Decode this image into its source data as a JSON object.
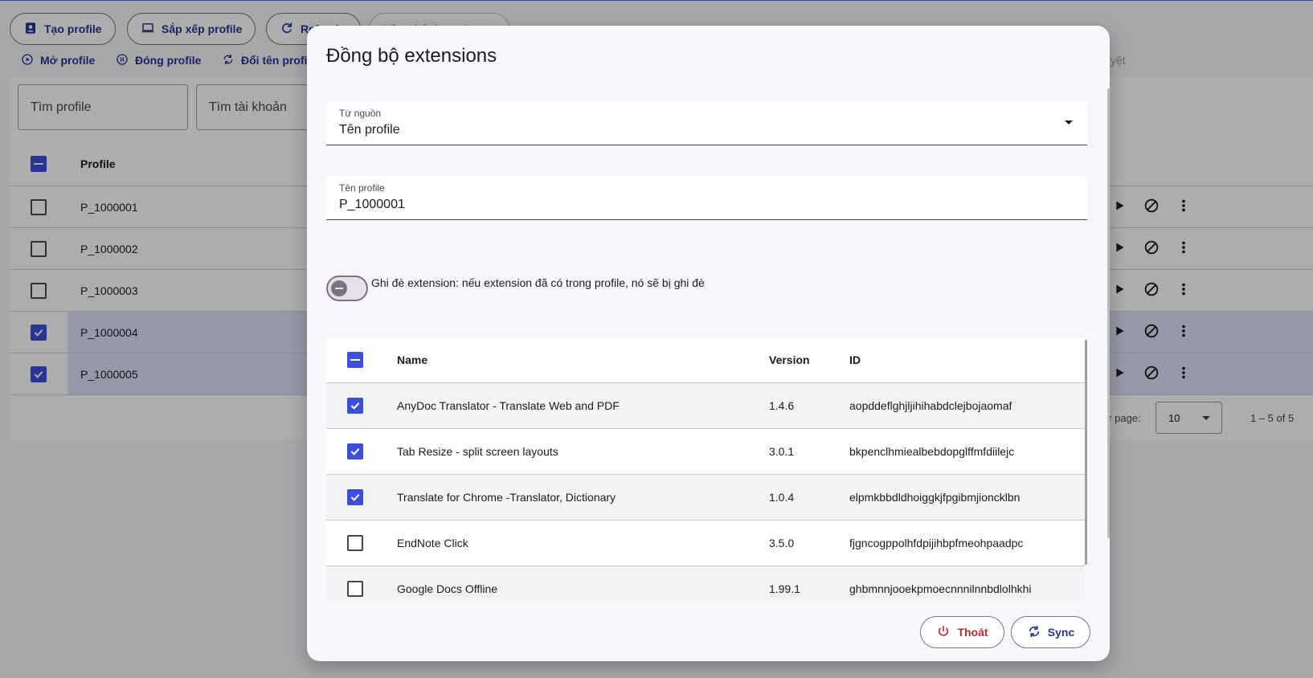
{
  "toolbar": {
    "create": "Tạo profile",
    "sort": "Sắp xếp profile",
    "refresh": "Refresh",
    "hidden_btn": "Đồng bộ thao tác",
    "open": "Mở profile",
    "close": "Đóng profile",
    "rename": "Đổi tên profil",
    "hidden_right": "yệt"
  },
  "search": {
    "profile_placeholder": "Tìm profile",
    "account_placeholder": "Tìm tài khoản"
  },
  "profile_table": {
    "header": "Profile",
    "rows": [
      {
        "name": "P_1000001",
        "checked": false
      },
      {
        "name": "P_1000002",
        "checked": false
      },
      {
        "name": "P_1000003",
        "checked": false
      },
      {
        "name": "P_1000004",
        "checked": true
      },
      {
        "name": "P_1000005",
        "checked": true
      }
    ]
  },
  "pagination": {
    "rows_per_page_label": "er page:",
    "rows_per_page": "10",
    "range": "1 – 5 of 5"
  },
  "dialog": {
    "title": "Đồng bộ extensions",
    "source_label": "Từ nguồn",
    "source_value": "Tên profile",
    "profile_label": "Tên profile",
    "profile_value": "P_1000001",
    "overwrite_label": "Ghi đè extension: nếu extension đã có trong profile, nó sẽ bị ghi đè",
    "overwrite_on": false,
    "columns": {
      "name": "Name",
      "version": "Version",
      "id": "ID"
    },
    "extensions": [
      {
        "name": "AnyDoc Translator - Translate Web and PDF",
        "version": "1.4.6",
        "id": "aopddeflghjljihihabdclejbojaomaf",
        "checked": true
      },
      {
        "name": "Tab Resize - split screen layouts",
        "version": "3.0.1",
        "id": "bkpenclhmiealbebdopglffmfdiilejc",
        "checked": true
      },
      {
        "name": "Translate for Chrome -Translator, Dictionary",
        "version": "1.0.4",
        "id": "elpmkbbdldhoiggkjfpgibmjioncklbn",
        "checked": true
      },
      {
        "name": "EndNote Click",
        "version": "3.5.0",
        "id": "fjgncogppolhfdpijihbpfmeohpaadpc",
        "checked": false
      },
      {
        "name": "Google Docs Offline",
        "version": "1.99.1",
        "id": "ghbmnnjooekpmoecnnnilnnbdlolhkhi",
        "checked": false
      }
    ],
    "exit_label": "Thoát",
    "sync_label": "Sync"
  },
  "colors": {
    "primary": "#3d4fd8",
    "primary_text": "#283593",
    "danger": "#c62828",
    "selected_row": "#dfe2fa"
  }
}
